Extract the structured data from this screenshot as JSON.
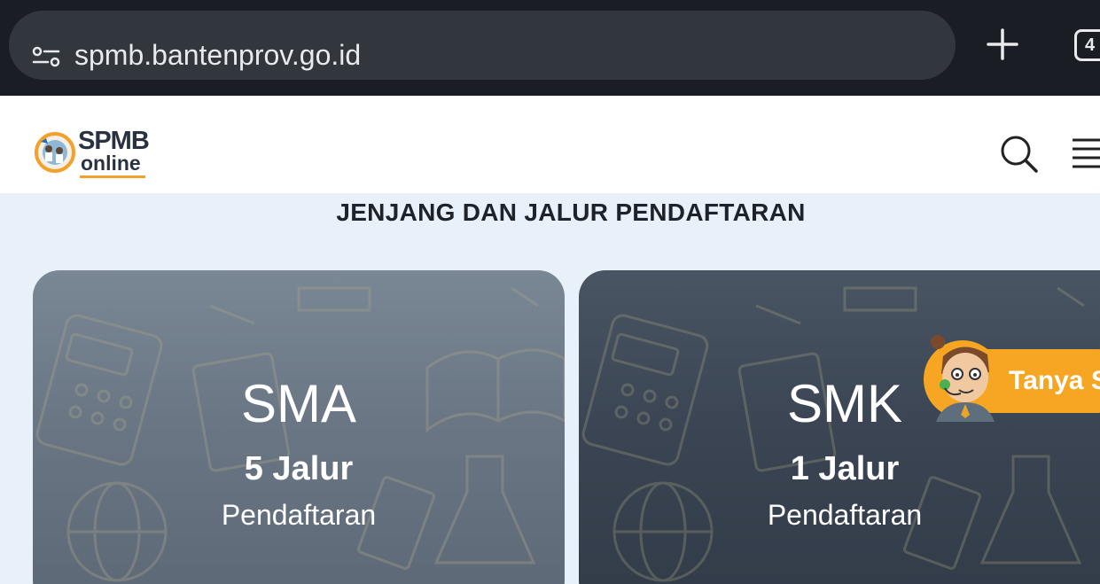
{
  "browser": {
    "url": "spmb.bantenprov.go.id",
    "tab_count": "4"
  },
  "header": {
    "logo_line1": "SPMB",
    "logo_line2": "online"
  },
  "section": {
    "title": "JENJANG DAN JALUR PENDAFTARAN"
  },
  "cards": [
    {
      "title": "SMA",
      "jalur": "5 Jalur",
      "subtitle": "Pendaftaran"
    },
    {
      "title": "SMK",
      "jalur": "1 Jalur",
      "subtitle": "Pendaftaran"
    }
  ],
  "chat": {
    "label": "Tanya S"
  },
  "icons": {
    "site_settings": "tune-icon",
    "new_tab": "plus-icon",
    "search": "search-icon",
    "menu": "hamburger-menu-icon"
  },
  "colors": {
    "chrome_bg": "#1a1d23",
    "urlbar_bg": "#32363d",
    "page_bg": "#e8f0f9",
    "accent_orange": "#f6a623",
    "card_sma": "#6a7684",
    "card_smk": "#3b4553"
  }
}
